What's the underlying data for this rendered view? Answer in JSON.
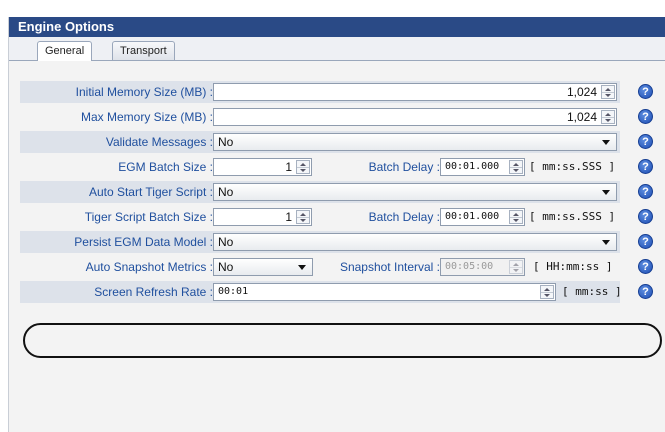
{
  "window": {
    "title": "Engine Options"
  },
  "tabs": [
    {
      "label": "General",
      "active": true
    },
    {
      "label": "Transport",
      "active": false
    }
  ],
  "rows": {
    "initial_memory": {
      "label": "Initial Memory Size (MB) :",
      "value": "1,024"
    },
    "max_memory": {
      "label": "Max Memory Size (MB) :",
      "value": "1,024"
    },
    "validate_messages": {
      "label": "Validate Messages :",
      "value": "No"
    },
    "egm_batch": {
      "label": "EGM Batch Size :",
      "value": "1",
      "delay_label": "Batch Delay :",
      "delay_value": "00:01.000",
      "unit": "[ mm:ss.SSS ]"
    },
    "auto_start": {
      "label": "Auto Start Tiger Script :",
      "value": "No"
    },
    "tiger_batch": {
      "label": "Tiger Script Batch Size :",
      "value": "1",
      "delay_label": "Batch Delay :",
      "delay_value": "00:01.000",
      "unit": "[ mm:ss.SSS ]"
    },
    "persist_egm": {
      "label": "Persist EGM Data Model :",
      "value": "No"
    },
    "auto_snapshot": {
      "label": "Auto Snapshot Metrics :",
      "value": "No",
      "interval_label": "Snapshot Interval :",
      "interval_value": "00:05:00",
      "unit": "[ HH:mm:ss ]"
    },
    "screen_refresh": {
      "label": "Screen Refresh Rate :",
      "value": "00:01",
      "unit": "[ mm:ss ]"
    }
  },
  "help_icon": {
    "glyph": "?"
  },
  "colors": {
    "header": "#2a4a86",
    "label": "#1f4f9e",
    "row_shade": "#dde2ea",
    "help": "#1d4db3"
  }
}
